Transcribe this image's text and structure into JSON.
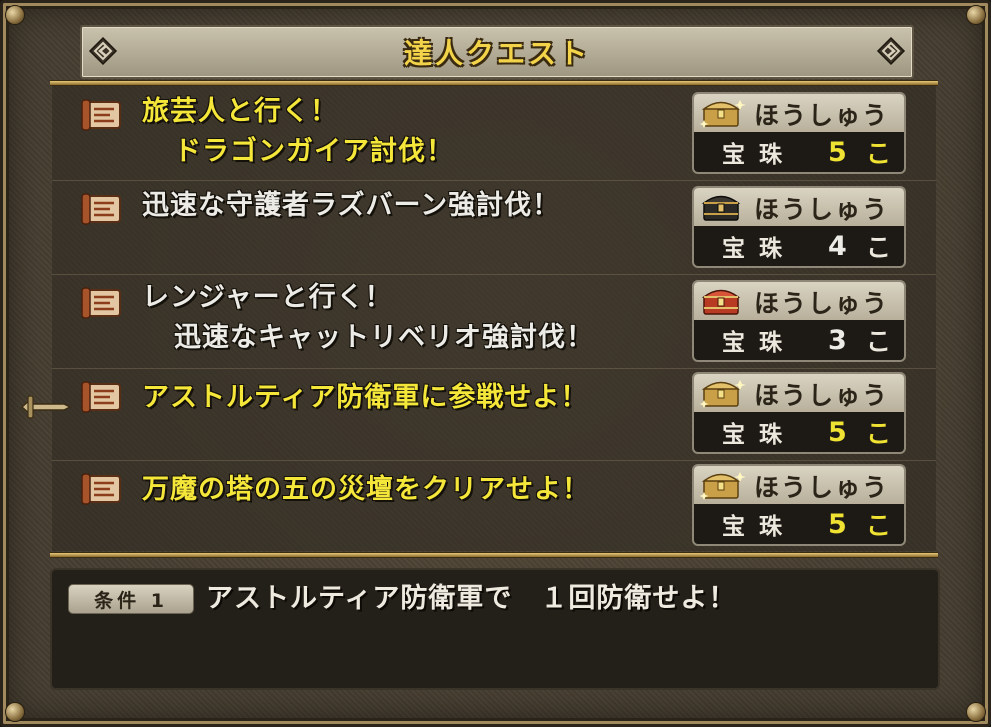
{
  "title": "達人クエスト",
  "colors": {
    "yellow_title": "#f5e63a",
    "white_title": "#ecebe6",
    "count_yellow": "#f0e232",
    "count_white": "#ecebe6"
  },
  "quests": [
    {
      "title_line1": "旅芸人と行く！",
      "title_line2": "ドラゴンガイア討伐！",
      "title_color": "yellow",
      "reward_label": "ほうしゅう",
      "reward_item": "宝珠",
      "reward_count": "5",
      "reward_unit": "こ",
      "chest_icon": "gold-chest-icon",
      "count_color": "yellow"
    },
    {
      "title_line1": "迅速な守護者ラズバーン強討伐！",
      "title_line2": "",
      "title_color": "white",
      "reward_label": "ほうしゅう",
      "reward_item": "宝珠",
      "reward_count": "4",
      "reward_unit": "こ",
      "chest_icon": "dark-chest-icon",
      "count_color": "white"
    },
    {
      "title_line1": "レンジャーと行く！",
      "title_line2": "迅速なキャットリベリオ強討伐！",
      "title_color": "white",
      "reward_label": "ほうしゅう",
      "reward_item": "宝珠",
      "reward_count": "3",
      "reward_unit": "こ",
      "chest_icon": "red-chest-icon",
      "count_color": "white"
    },
    {
      "title_line1": "アストルティア防衛軍に参戦せよ！",
      "title_line2": "",
      "title_color": "yellow",
      "reward_label": "ほうしゅう",
      "reward_item": "宝珠",
      "reward_count": "5",
      "reward_unit": "こ",
      "chest_icon": "gold-chest-icon",
      "count_color": "yellow"
    },
    {
      "title_line1": "万魔の塔の五の災壇をクリアせよ！",
      "title_line2": "",
      "title_color": "yellow",
      "reward_label": "ほうしゅう",
      "reward_item": "宝珠",
      "reward_count": "5",
      "reward_unit": "こ",
      "chest_icon": "gold-chest-icon",
      "count_color": "yellow"
    }
  ],
  "condition": {
    "badge": "条件 1",
    "text": "アストルティア防衛軍で　１回防衛せよ！"
  },
  "selected_index": 3
}
